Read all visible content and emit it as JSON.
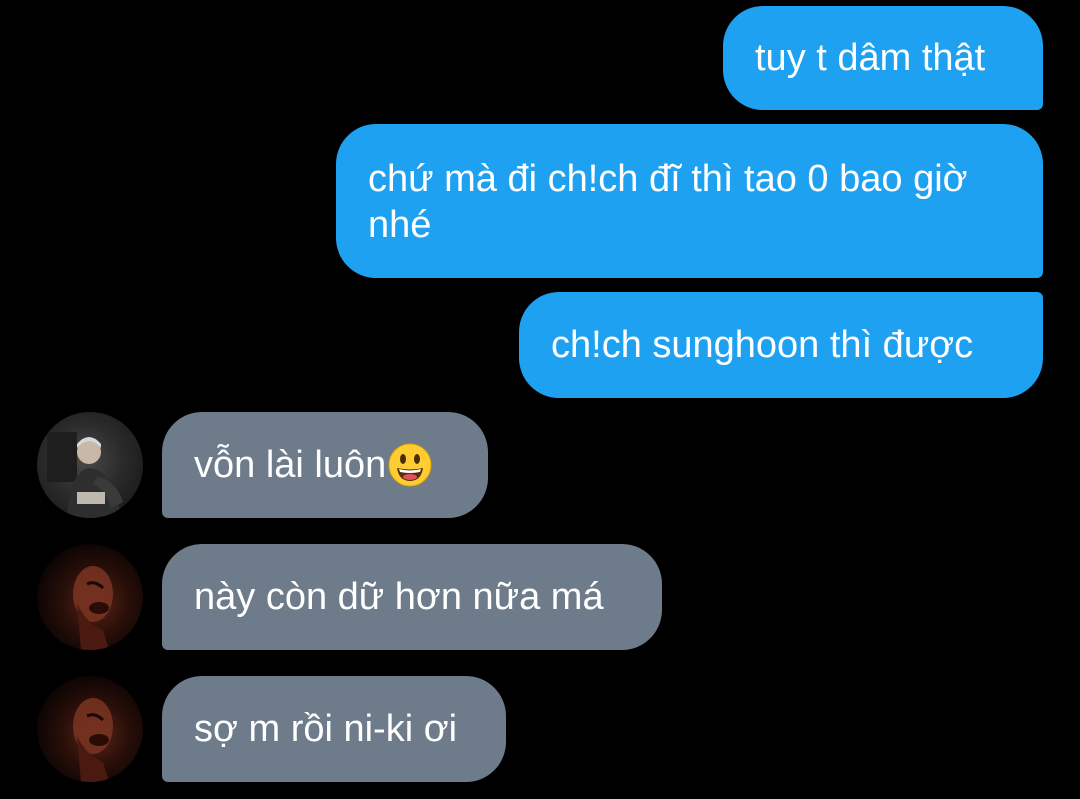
{
  "messages": [
    {
      "direction": "sent",
      "text": "tuy t dâm thật"
    },
    {
      "direction": "sent",
      "text": "chứ mà đi ch!ch đĩ thì tao 0 bao giờ nhé"
    },
    {
      "direction": "sent",
      "text": "ch!ch sunghoon thì được"
    },
    {
      "direction": "received",
      "text": "vỗn lài luôn",
      "emoji": "grinning-face"
    },
    {
      "direction": "received",
      "text": "này còn dữ hơn nữa má"
    },
    {
      "direction": "received",
      "text": "sợ m rồi ni-ki ơi"
    }
  ],
  "colors": {
    "background": "#000000",
    "sent_bubble": "#1fa1f1",
    "received_bubble": "#6e7b8a",
    "text": "#ffffff"
  }
}
